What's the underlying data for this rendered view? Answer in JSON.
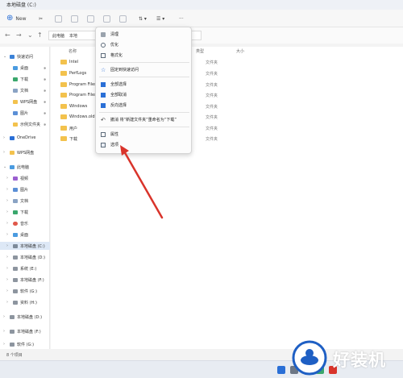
{
  "window": {
    "title": "本地磁盘 (C:)"
  },
  "toolbar": {
    "new_label": "New"
  },
  "address": {
    "crumbs": [
      "此电脑",
      "本地"
    ]
  },
  "sidebar": {
    "items": [
      {
        "label": "快速访问",
        "icon": "star-icon"
      },
      {
        "label": "桌面",
        "icon": "desktop-icon"
      },
      {
        "label": "下载",
        "icon": "download-icon"
      },
      {
        "label": "文档",
        "icon": "document-icon"
      },
      {
        "label": "WPS网盘",
        "icon": "cloud-icon"
      },
      {
        "label": "图片",
        "icon": "picture-icon"
      },
      {
        "label": "示例文件夹",
        "icon": "folder-icon"
      },
      {
        "label": "OneDrive",
        "icon": "onedrive-icon"
      },
      {
        "label": "WPS网盘",
        "icon": "cloud-icon"
      },
      {
        "label": "此电脑",
        "icon": "computer-icon"
      },
      {
        "label": "视频",
        "icon": "video-icon"
      },
      {
        "label": "图片",
        "icon": "picture-icon"
      },
      {
        "label": "文档",
        "icon": "document-icon"
      },
      {
        "label": "下载",
        "icon": "download-icon"
      },
      {
        "label": "音乐",
        "icon": "music-icon"
      },
      {
        "label": "桌面",
        "icon": "desktop-icon"
      },
      {
        "label": "本地磁盘 (C:)",
        "icon": "drive-icon"
      },
      {
        "label": "本地磁盘 (D:)",
        "icon": "drive-icon"
      },
      {
        "label": "系统 (E:)",
        "icon": "drive-icon"
      },
      {
        "label": "本地磁盘 (F:)",
        "icon": "drive-icon"
      },
      {
        "label": "软件 (G:)",
        "icon": "drive-icon"
      },
      {
        "label": "资料 (H:)",
        "icon": "drive-icon"
      },
      {
        "label": "本地磁盘 (D:)",
        "icon": "drive-icon"
      },
      {
        "label": "本地磁盘 (F:)",
        "icon": "drive-icon"
      },
      {
        "label": "软件 (G:)",
        "icon": "drive-icon"
      }
    ]
  },
  "columns": {
    "name": "名称",
    "type": "类型",
    "size": "大小"
  },
  "files": [
    {
      "name": "Intel",
      "type": "文件夹"
    },
    {
      "name": "PerfLogs",
      "type": "文件夹"
    },
    {
      "name": "Program Files",
      "type": "文件夹"
    },
    {
      "name": "Program Files",
      "type": "文件夹"
    },
    {
      "name": "Windows",
      "type": "文件夹"
    },
    {
      "name": "Windows.old",
      "type": "文件夹"
    },
    {
      "name": "用户",
      "type": "文件夹"
    },
    {
      "name": "下载",
      "type": "文件夹"
    }
  ],
  "context_menu": {
    "items": [
      {
        "label": "清理"
      },
      {
        "label": "优化"
      },
      {
        "label": "格式化"
      },
      {
        "label": "固定到快速访问"
      },
      {
        "label": "全部选择"
      },
      {
        "label": "全部取消"
      },
      {
        "label": "反向选择"
      },
      {
        "label": "撤消 将“新建文件夹”重命名为“下载”"
      },
      {
        "label": "属性"
      },
      {
        "label": "选项"
      }
    ]
  },
  "status": {
    "count": "8 个项目"
  },
  "watermark": {
    "text": "好装机"
  },
  "colors": {
    "arrow": "#d9342b",
    "folder": "#f3c24d",
    "accent": "#2a6fd6"
  }
}
